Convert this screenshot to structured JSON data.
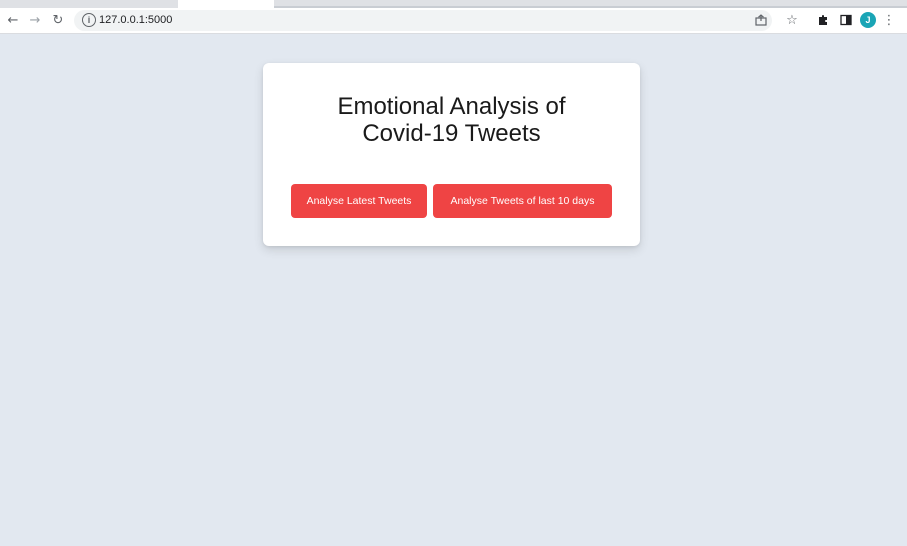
{
  "browser": {
    "url": "127.0.0.1:5000",
    "avatar_initial": "J",
    "icons": {
      "back": "arrow-left-icon",
      "forward": "arrow-right-icon",
      "reload": "reload-icon",
      "site_info": "info-icon",
      "share": "share-icon",
      "bookmark": "star-icon",
      "extensions": "puzzle-icon",
      "side_panel": "side-panel-icon",
      "menu": "kebab-menu-icon"
    }
  },
  "main": {
    "title_line1": "Emotional Analysis of",
    "title_line2": "Covid-19 Tweets",
    "buttons": {
      "latest": "Analyse Latest Tweets",
      "last_10_days": "Analyse Tweets of last 10 days"
    }
  },
  "colors": {
    "page_background": "#e2e8f0",
    "button": "#ef4444",
    "avatar": "#1aa5b6"
  }
}
